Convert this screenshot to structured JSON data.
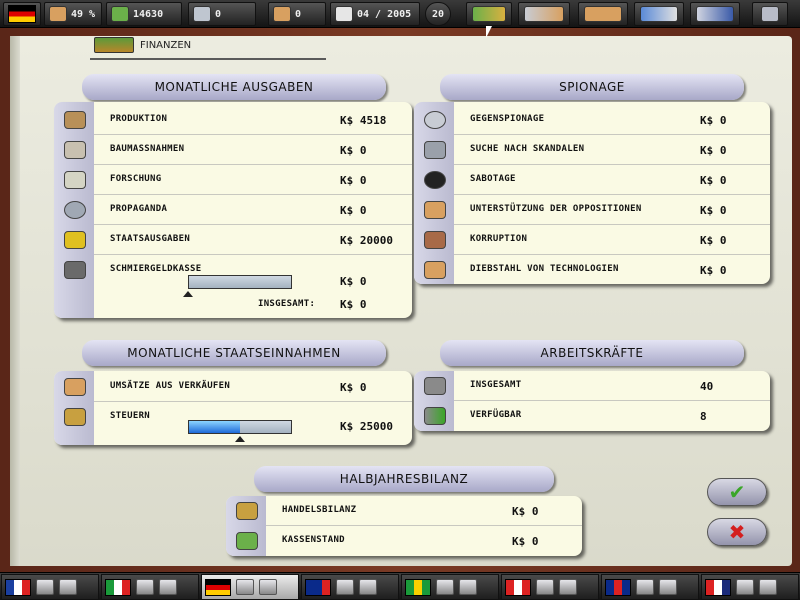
{
  "topbar": {
    "approval": "49 %",
    "money": "14630",
    "stat3": "0",
    "stat4": "0",
    "date": "04 / 2005",
    "turn": "20",
    "tab_icons": [
      "finance-tab-icon",
      "diplomacy-tab-icon",
      "trade-tab-icon",
      "globe-tab-icon",
      "statistics-tab-icon",
      "save-disk-icon"
    ]
  },
  "header": {
    "title": "FINANZEN"
  },
  "expenses": {
    "title": "MONATLICHE AUSGABEN",
    "rows": [
      {
        "icon": "factory-icon",
        "label": "PRODUKTION",
        "value": "K$ 4518"
      },
      {
        "icon": "construction-icon",
        "label": "BAUMASSNAHMEN",
        "value": "K$ 0"
      },
      {
        "icon": "microscope-icon",
        "label": "FORSCHUNG",
        "value": "K$ 0"
      },
      {
        "icon": "propaganda-icon",
        "label": "PROPAGANDA",
        "value": "K$ 0"
      },
      {
        "icon": "gears-icon",
        "label": "STAATSAUSGABEN",
        "value": "K$ 20000"
      }
    ],
    "slush": {
      "icon": "chest-icon",
      "label": "SCHMIERGELDKASSE",
      "value": "K$ 0",
      "level": 0
    },
    "total_label": "INSGESAMT:",
    "total_value": "K$ 0"
  },
  "espionage": {
    "title": "SPIONAGE",
    "rows": [
      {
        "icon": "magnifier-icon",
        "label": "GEGENSPIONAGE",
        "value": "K$ 0"
      },
      {
        "icon": "camera-icon",
        "label": "SUCHE NACH SKANDALEN",
        "value": "K$ 0"
      },
      {
        "icon": "bomb-icon",
        "label": "SABOTAGE",
        "value": "K$ 0"
      },
      {
        "icon": "thumbs-down-icon",
        "label": "UNTERSTÜTZUNG DER OPPOSITIONEN",
        "value": "K$ 0"
      },
      {
        "icon": "bribe-icon",
        "label": "KORRUPTION",
        "value": "K$ 0"
      },
      {
        "icon": "theft-hand-icon",
        "label": "DIEBSTAHL VON TECHNOLOGIEN",
        "value": "K$ 0"
      }
    ]
  },
  "revenue": {
    "title": "MONATLICHE STAATSEINNAHMEN",
    "rows": [
      {
        "icon": "trade-icon",
        "label": "UMSÄTZE AUS VERKÄUFEN",
        "value": "K$ 0"
      }
    ],
    "taxes": {
      "icon": "tax-icon",
      "label": "STEUERN",
      "value": "K$ 25000",
      "level": 0.5
    }
  },
  "workforce": {
    "title": "ARBEITSKRÄFTE",
    "rows": [
      {
        "icon": "workers-icon",
        "label": "INSGESAMT",
        "value": "40"
      },
      {
        "icon": "workers-check-icon",
        "label": "VERFÜGBAR",
        "value": "8"
      }
    ]
  },
  "half_year": {
    "title": "HALBJAHRESBILANZ",
    "rows": [
      {
        "icon": "scales-icon",
        "label": "HANDELSBILANZ",
        "value": "K$ 0"
      },
      {
        "icon": "cash-icon",
        "label": "KASSENSTAND",
        "value": "K$ 0"
      }
    ]
  },
  "buttons": {
    "ok": "✔",
    "cancel": "✖"
  },
  "nations": [
    {
      "name": "france",
      "flag": [
        "#1a3fa0",
        "#ffffff",
        "#d22"
      ]
    },
    {
      "name": "italy",
      "flag": [
        "#1a9a3a",
        "#ffffff",
        "#d22"
      ]
    },
    {
      "name": "germany",
      "flag": [
        "#000",
        "#d00",
        "#fc0"
      ],
      "active": true
    },
    {
      "name": "australia",
      "flag": [
        "#0a2a8a",
        "#0a2a8a",
        "#d22"
      ]
    },
    {
      "name": "brazil",
      "flag": [
        "#1a9a3a",
        "#f8d000",
        "#1a9a3a"
      ]
    },
    {
      "name": "canada",
      "flag": [
        "#d22",
        "#ffffff",
        "#d22"
      ]
    },
    {
      "name": "united-kingdom",
      "flag": [
        "#0a2a8a",
        "#d22",
        "#0a2a8a"
      ]
    },
    {
      "name": "usa",
      "flag": [
        "#d22",
        "#ffffff",
        "#1a2a7a"
      ]
    }
  ]
}
